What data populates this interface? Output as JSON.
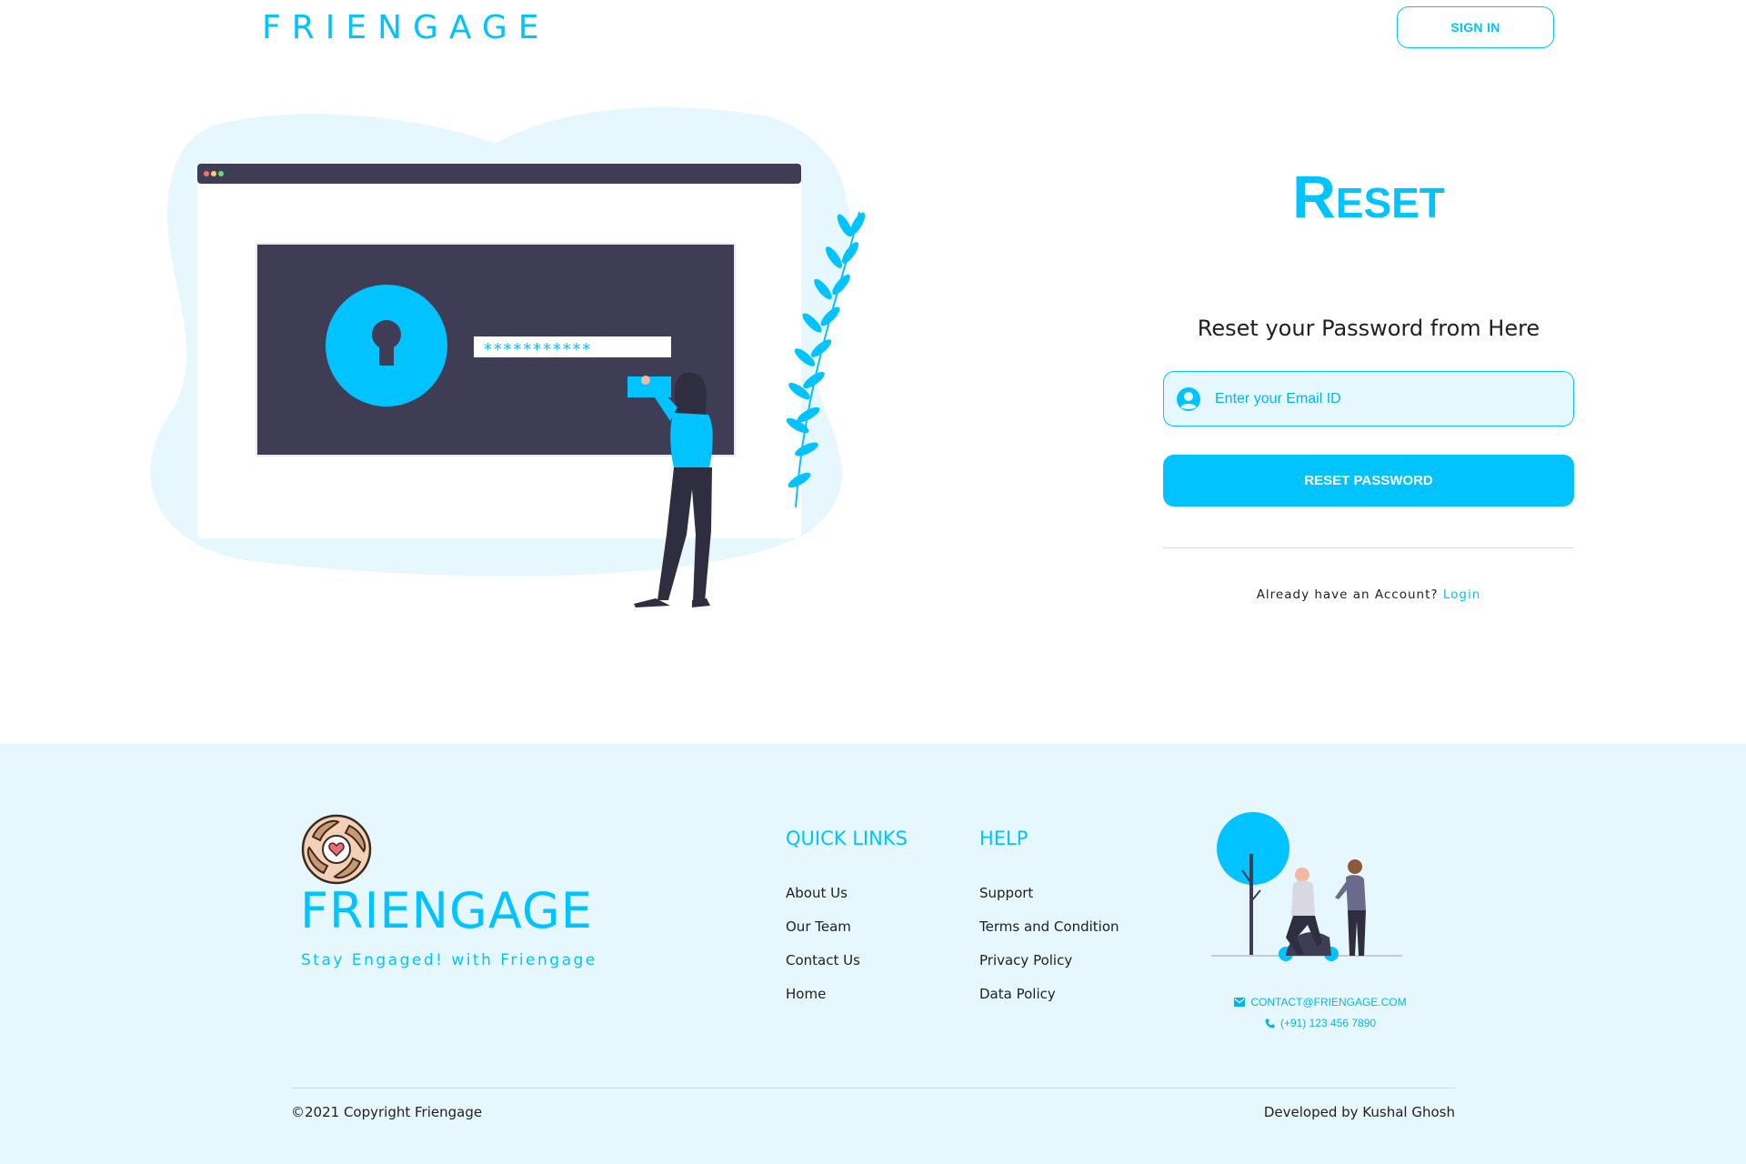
{
  "header": {
    "brand": "FRIENGAGE",
    "signin_label": "SIGN IN"
  },
  "hero": {
    "illustration": "password-reset-illustration",
    "password_mask": "***********"
  },
  "form": {
    "title": "Reset",
    "subtitle": "Reset your Password from Here",
    "email_placeholder": "Enter your Email ID",
    "email_icon": "user-circle-icon",
    "submit_label": "RESET PASSWORD",
    "account_prompt": "Already have an Account?",
    "login_label": "Login"
  },
  "footer": {
    "logo": "hands-heart-logo",
    "brand": "FRIENGAGE",
    "tagline": "Stay Engaged! with Friengage",
    "quick_links": {
      "title": "QUICK LINKS",
      "items": [
        "About Us",
        "Our Team",
        "Contact Us",
        "Home"
      ]
    },
    "help": {
      "title": "HELP",
      "items": [
        "Support",
        "Terms and Condition",
        "Privacy Policy",
        "Data Policy"
      ]
    },
    "contact": {
      "email": "CONTACT@FRIENGAGE.COM",
      "phone": "(+91) 123 456 7890"
    },
    "copyright": "©2021 Copyright Friengage",
    "developer": "Developed by Kushal Ghosh"
  },
  "colors": {
    "accent": "#00c3ff",
    "footer_bg": "#e6f8fd",
    "dark": "#3f3d56"
  }
}
